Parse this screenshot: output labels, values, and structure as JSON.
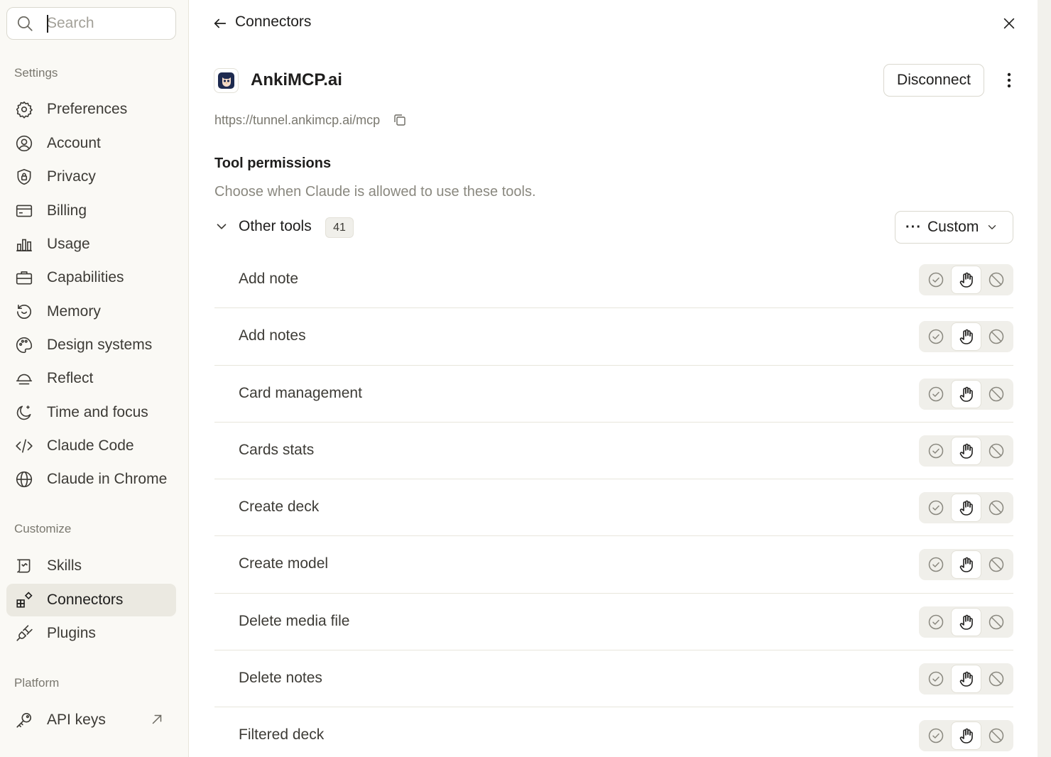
{
  "sidebar": {
    "search": {
      "placeholder": "Search",
      "value": ""
    },
    "sections": [
      {
        "label": "Settings",
        "items": [
          {
            "label": "Preferences",
            "icon": "gear-icon"
          },
          {
            "label": "Account",
            "icon": "user-circle-icon"
          },
          {
            "label": "Privacy",
            "icon": "shield-lock-icon"
          },
          {
            "label": "Billing",
            "icon": "credit-card-icon"
          },
          {
            "label": "Usage",
            "icon": "bar-chart-icon"
          },
          {
            "label": "Capabilities",
            "icon": "briefcase-icon"
          },
          {
            "label": "Memory",
            "icon": "history-icon"
          },
          {
            "label": "Design systems",
            "icon": "palette-icon"
          },
          {
            "label": "Reflect",
            "icon": "bell-dome-icon"
          },
          {
            "label": "Time and focus",
            "icon": "moon-icon"
          },
          {
            "label": "Claude Code",
            "icon": "code-icon"
          },
          {
            "label": "Claude in Chrome",
            "icon": "globe-icon"
          }
        ]
      },
      {
        "label": "Customize",
        "items": [
          {
            "label": "Skills",
            "icon": "scroll-icon"
          },
          {
            "label": "Connectors",
            "icon": "connectors-icon",
            "active": true
          },
          {
            "label": "Plugins",
            "icon": "plug-icon"
          }
        ]
      },
      {
        "label": "Platform",
        "items": [
          {
            "label": "API keys",
            "icon": "key-icon",
            "external": true
          }
        ]
      }
    ]
  },
  "header": {
    "breadcrumb": "Connectors"
  },
  "connector": {
    "name": "AnkiMCP.ai",
    "url": "https://tunnel.ankimcp.ai/mcp",
    "disconnect_label": "Disconnect",
    "logo_color": "#1e2a4f"
  },
  "permissions": {
    "title": "Tool permissions",
    "subtitle": "Choose when Claude is allowed to use these tools.",
    "group": {
      "label": "Other tools",
      "count": "41",
      "mode_label": "Custom"
    },
    "tools": [
      {
        "name": "Add note",
        "permission": "ask"
      },
      {
        "name": "Add notes",
        "permission": "ask"
      },
      {
        "name": "Card management",
        "permission": "ask"
      },
      {
        "name": "Cards stats",
        "permission": "ask"
      },
      {
        "name": "Create deck",
        "permission": "ask"
      },
      {
        "name": "Create model",
        "permission": "ask"
      },
      {
        "name": "Delete media file",
        "permission": "ask"
      },
      {
        "name": "Delete notes",
        "permission": "ask"
      },
      {
        "name": "Filtered deck",
        "permission": "ask"
      }
    ]
  },
  "colors": {
    "sidebar_bg": "#faf9f5",
    "active_item_bg": "#ebe9e1",
    "segment_bg": "#f0efea",
    "text_primary": "#1f1e1d",
    "text_muted": "#8a887f"
  }
}
